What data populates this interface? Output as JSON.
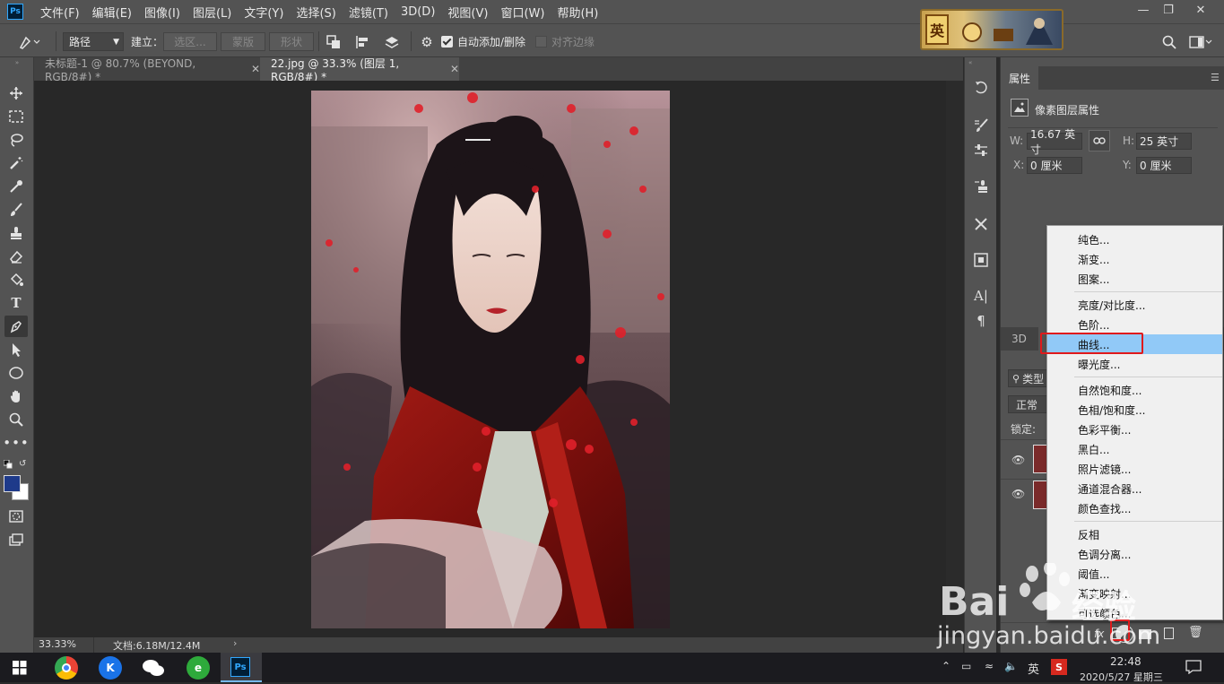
{
  "app": {
    "logo": "Ps"
  },
  "menu": [
    "文件(F)",
    "编辑(E)",
    "图像(I)",
    "图层(L)",
    "文字(Y)",
    "选择(S)",
    "滤镜(T)",
    "3D(D)",
    "视图(V)",
    "窗口(W)",
    "帮助(H)"
  ],
  "banner": {
    "char": "英"
  },
  "options": {
    "mode": "路径",
    "build_label": "建立：",
    "selection_btn": "选区...",
    "mask_btn": "蒙版",
    "shape_btn": "形状",
    "auto_add_delete": "自动添加/删除",
    "align_edges": "对齐边缘"
  },
  "tabs": [
    {
      "label": "未标题-1 @ 80.7% (BEYOND, RGB/8#) *",
      "active": false
    },
    {
      "label": "22.jpg @ 33.3% (图层 1, RGB/8#) *",
      "active": true
    }
  ],
  "status": {
    "zoom": "33.33%",
    "doc": "文档:6.18M/12.4M"
  },
  "properties": {
    "title": "属性",
    "subtitle": "像素图层属性",
    "w_label": "W:",
    "w_value": "16.67 英寸",
    "h_label": "H:",
    "h_value": "25 英寸",
    "x_label": "X:",
    "x_value": "0 厘米",
    "y_label": "Y:",
    "y_value": "0 厘米"
  },
  "layers": {
    "tab_3d": "3D",
    "filter_label": "类型",
    "blend_mode": "正常",
    "lock_label": "锁定:"
  },
  "dropdown": {
    "groups": [
      [
        "纯色...",
        "渐变...",
        "图案..."
      ],
      [
        "亮度/对比度...",
        "色阶...",
        "曲线...",
        "曝光度..."
      ],
      [
        "自然饱和度...",
        "色相/饱和度...",
        "色彩平衡...",
        "黑白...",
        "照片滤镜...",
        "通道混合器...",
        "颜色查找..."
      ],
      [
        "反相",
        "色调分离...",
        "阈值...",
        "渐变映射...",
        "可选颜色..."
      ]
    ],
    "highlighted": "曲线..."
  },
  "watermark": {
    "brand": "Bai",
    "brand2": "经验",
    "url": "jingyan.baidu.com"
  },
  "taskbar": {
    "ime": "英",
    "time": "22:48",
    "date": "2020/5/27 星期三",
    "ps_label": "Ps"
  },
  "colors": {
    "foreground": "#1e3a8a",
    "background": "#ffffff",
    "highlight": "#91c9f7",
    "annotation": "#e0191b"
  }
}
